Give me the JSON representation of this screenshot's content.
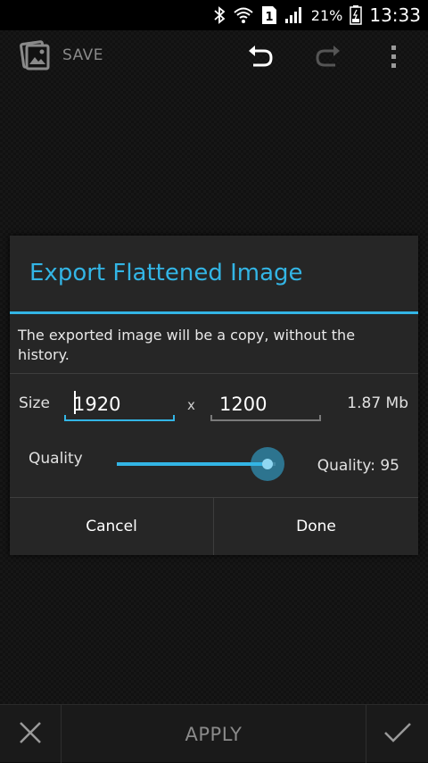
{
  "status_bar": {
    "battery_percent": "21%",
    "time": "13:33",
    "sim_slot": "1",
    "icons": [
      "bluetooth-icon",
      "wifi-icon",
      "sim-icon",
      "signal-icon",
      "battery-icon"
    ]
  },
  "action_bar": {
    "save_label": "SAVE",
    "icons": [
      "app-image-icon",
      "undo-icon",
      "redo-icon",
      "overflow-menu-icon"
    ]
  },
  "dialog": {
    "title": "Export Flattened Image",
    "message": "The exported image will be a copy, without the history.",
    "size_label": "Size",
    "width_value": "1920",
    "separator": "x",
    "height_value": "1200",
    "file_size": "1.87 Mb",
    "quality_label": "Quality",
    "quality_value_text": "Quality: 95",
    "quality_value": 95,
    "quality_max": 100,
    "cancel_label": "Cancel",
    "done_label": "Done"
  },
  "bottom_bar": {
    "apply_label": "APPLY",
    "icons": [
      "close-icon",
      "checkmark-icon"
    ]
  },
  "colors": {
    "accent": "#33b5e5",
    "dialog_background": "#262626",
    "screen_background": "#111111"
  }
}
